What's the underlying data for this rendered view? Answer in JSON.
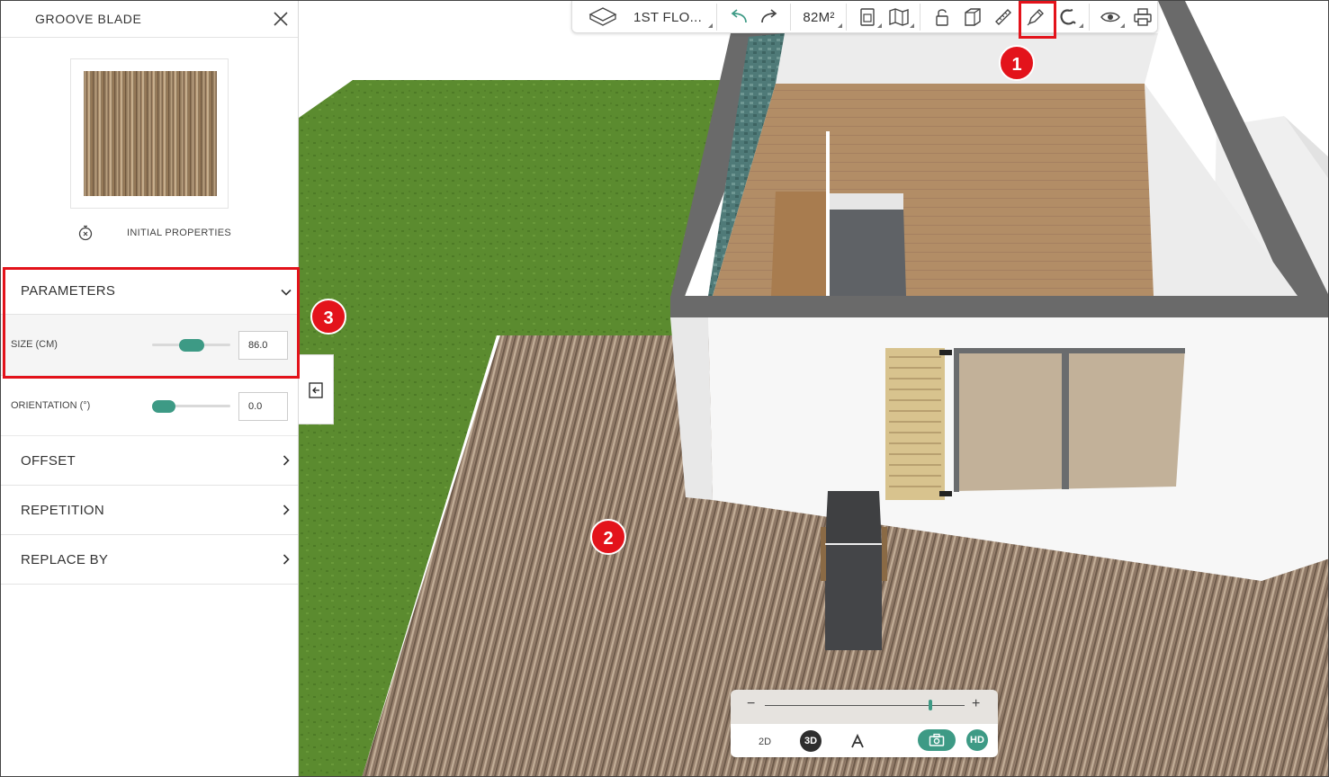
{
  "panel": {
    "title": "GROOVE BLADE",
    "initial_properties_label": "INITIAL PROPERTIES",
    "sections": {
      "parameters": "PARAMETERS",
      "offset": "OFFSET",
      "repetition": "REPETITION",
      "replace_by": "REPLACE BY"
    },
    "params": [
      {
        "label": "SIZE (CM)",
        "value": "86.0",
        "slider_level": 0.5
      },
      {
        "label": "ORIENTATION (°)",
        "value": "0.0",
        "slider_level": 0.0
      }
    ]
  },
  "toolbar": {
    "floor_label": "1ST FLO...",
    "area_label": "82M²",
    "icons": [
      "floor-plan-icon",
      "undo-icon",
      "redo-icon",
      "document-icon",
      "map-icon",
      "lock-icon",
      "cube-icon",
      "ruler-icon",
      "pencil-icon",
      "magnet-icon",
      "eye-icon",
      "print-icon"
    ]
  },
  "view_panel": {
    "minus": "−",
    "plus": "+",
    "zoom_level": 0.83,
    "btn_2d": "2D",
    "btn_3d": "3D",
    "btn_hd": "HD"
  },
  "annotations": [
    "1",
    "2",
    "3"
  ],
  "colors": {
    "accent": "#3d9a85",
    "highlight": "#e3131b",
    "grass": "#5a8a2e",
    "deck": "#9c8470"
  }
}
